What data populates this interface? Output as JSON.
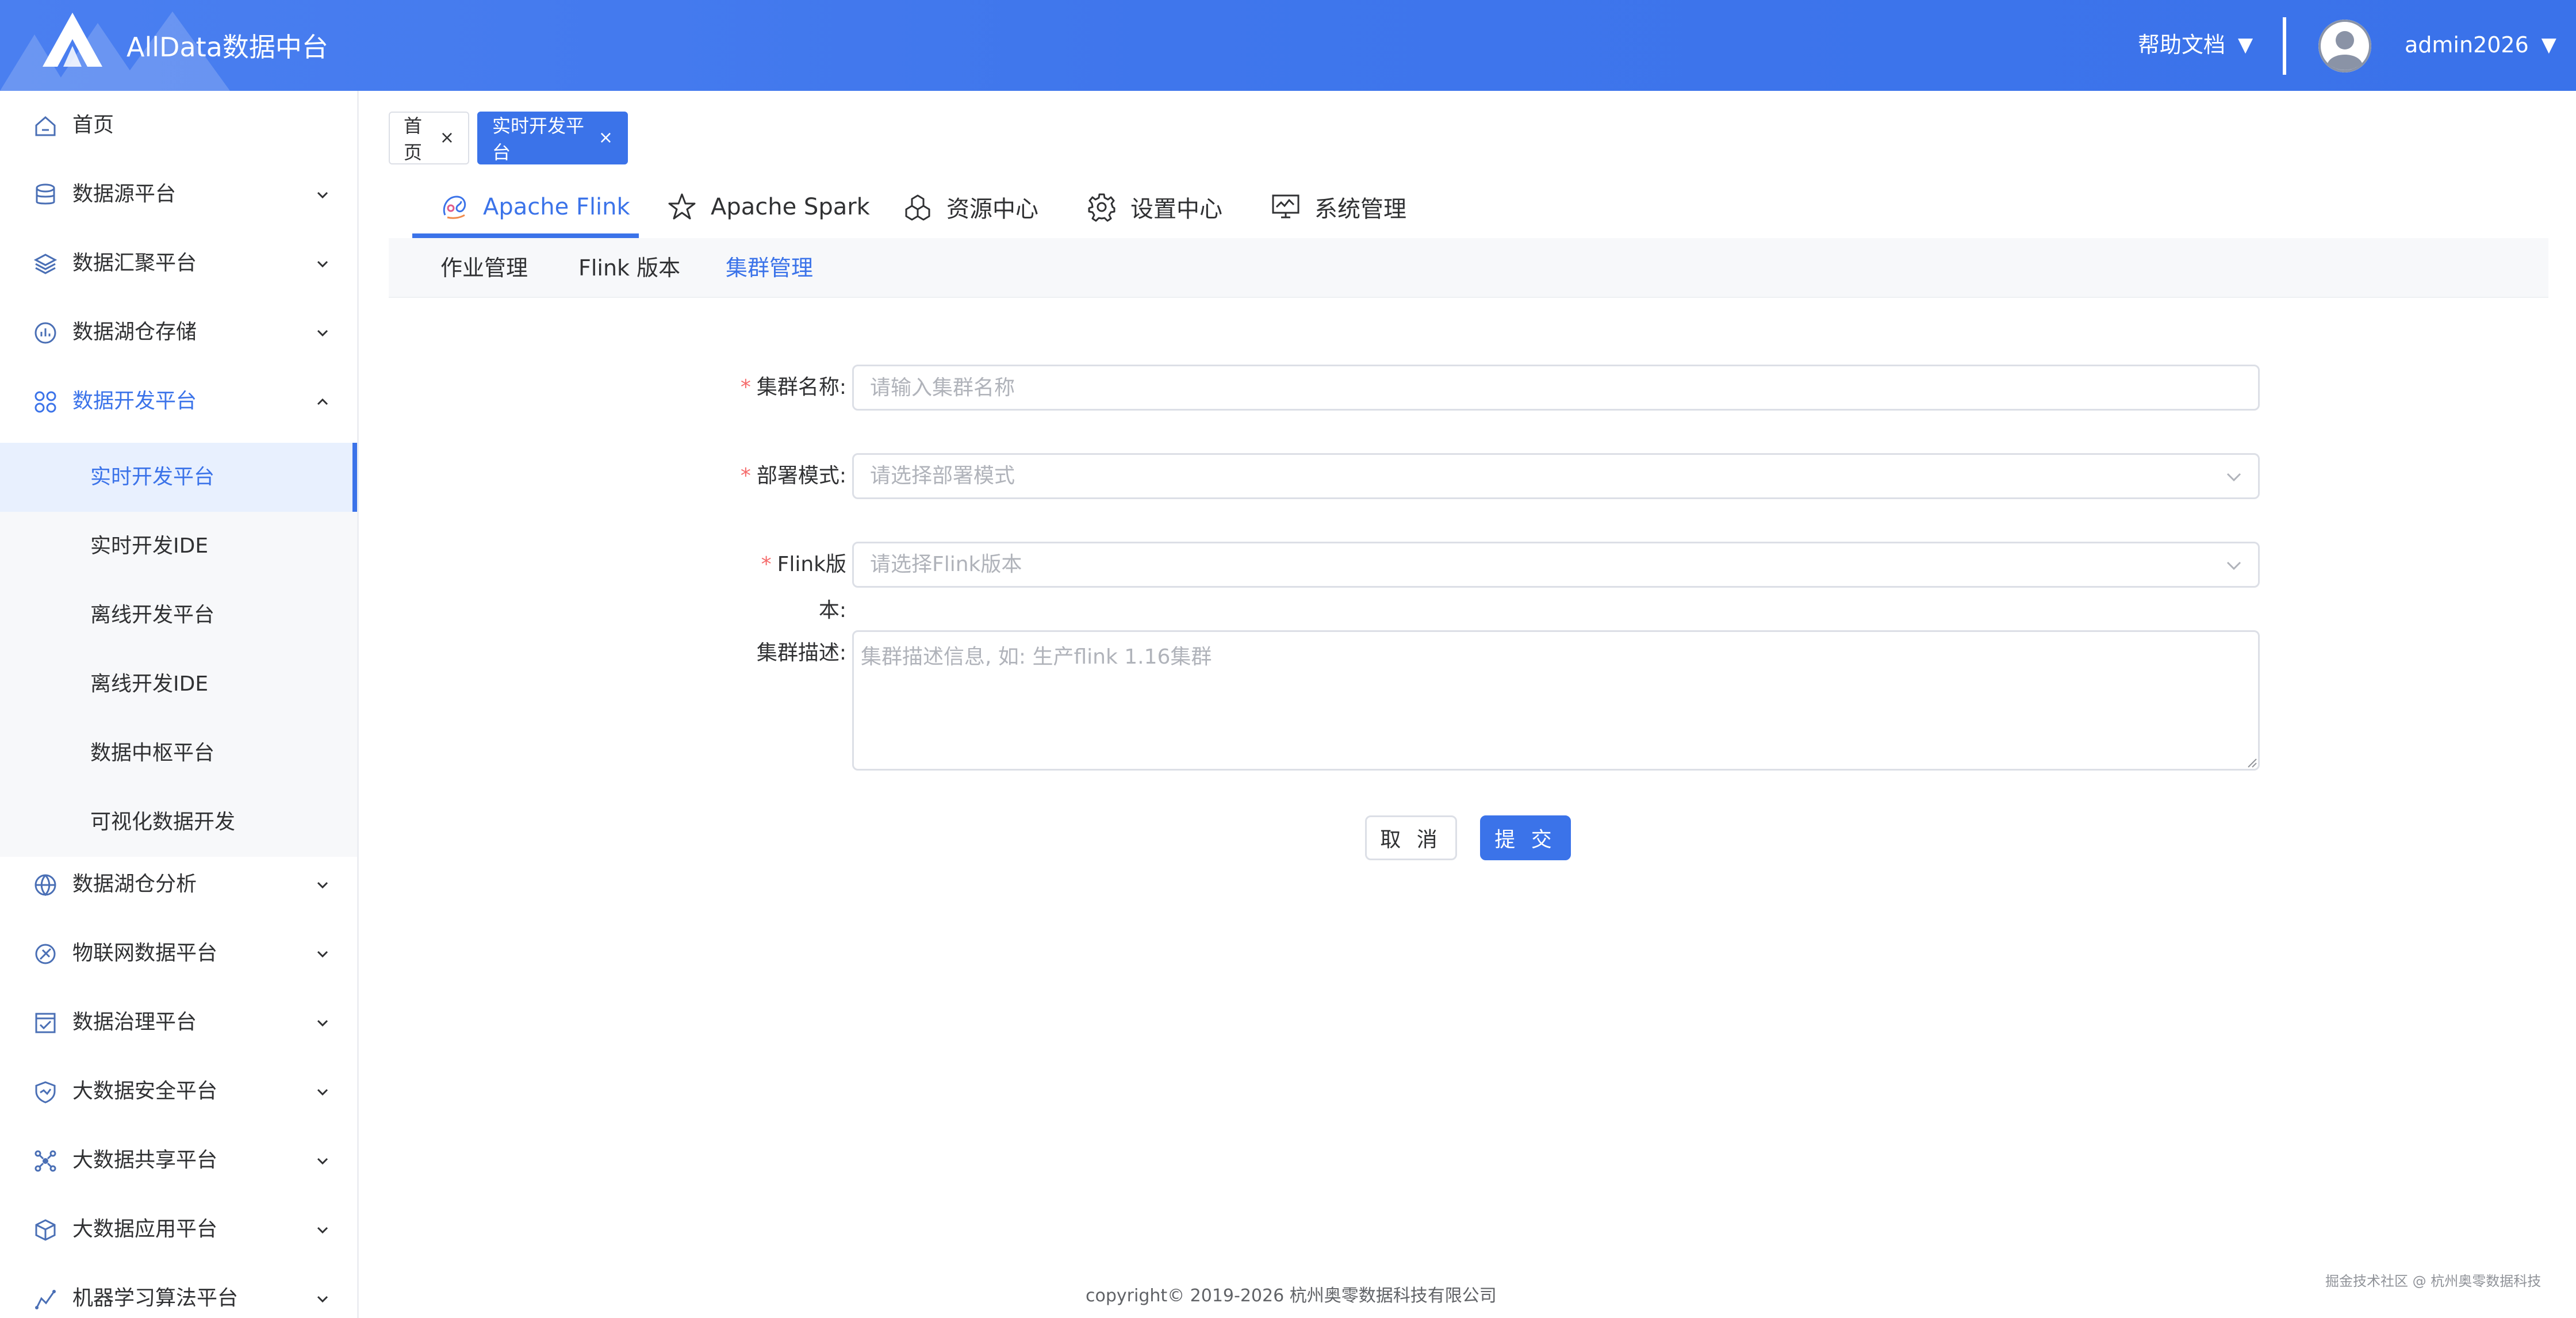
{
  "header": {
    "app_title": "AllData数据中台",
    "help_label": "帮助文档",
    "username": "admin2026"
  },
  "sidebar": {
    "items": [
      {
        "label": "首页"
      },
      {
        "label": "数据源平台"
      },
      {
        "label": "数据汇聚平台"
      },
      {
        "label": "数据湖仓存储"
      },
      {
        "label": "数据开发平台"
      },
      {
        "label": "数据湖仓分析"
      },
      {
        "label": "物联网数据平台"
      },
      {
        "label": "数据治理平台"
      },
      {
        "label": "大数据安全平台"
      },
      {
        "label": "大数据共享平台"
      },
      {
        "label": "大数据应用平台"
      },
      {
        "label": "机器学习算法平台"
      }
    ],
    "expanded_group": "数据开发平台",
    "sub_items": [
      {
        "label": "实时开发平台"
      },
      {
        "label": "实时开发IDE"
      },
      {
        "label": "离线开发平台"
      },
      {
        "label": "离线开发IDE"
      },
      {
        "label": "数据中枢平台"
      },
      {
        "label": "可视化数据开发"
      }
    ],
    "active_sub_item": "实时开发平台"
  },
  "page_tabs": [
    {
      "label": "首页",
      "close": "×"
    },
    {
      "label": "实时开发平台",
      "close": "×"
    }
  ],
  "module_tabs": [
    {
      "label": "Apache Flink",
      "icon": "flink-icon"
    },
    {
      "label": "Apache Spark",
      "icon": "spark-icon"
    },
    {
      "label": "资源中心",
      "icon": "resource-icon"
    },
    {
      "label": "设置中心",
      "icon": "gear-icon"
    },
    {
      "label": "系统管理",
      "icon": "monitor-icon"
    }
  ],
  "active_module_tab": "Apache Flink",
  "sub_nav": [
    {
      "label": "作业管理"
    },
    {
      "label": "Flink 版本"
    },
    {
      "label": "集群管理"
    }
  ],
  "active_sub_nav": "集群管理",
  "form": {
    "required_mark": "*",
    "cluster_name_label": "集群名称:",
    "cluster_name_placeholder": "请输入集群名称",
    "deploy_mode_label": "部署模式:",
    "deploy_mode_placeholder": "请选择部署模式",
    "flink_version_label": "Flink版本:",
    "flink_version_placeholder": "请选择Flink版本",
    "description_label": "集群描述:",
    "description_placeholder": "集群描述信息, 如: 生产flink 1.16集群",
    "cancel_label": "取 消",
    "submit_label": "提 交"
  },
  "footer": {
    "copyright": "copyright© 2019-2026 杭州奥零数据科技有限公司",
    "watermark": "掘金技术社区 @ 杭州奥零数据科技"
  },
  "colors": {
    "primary": "#3b73e9",
    "header_bg": "#4279ed",
    "required": "#f56c6c",
    "submenu_bg": "#f7f8fa"
  }
}
